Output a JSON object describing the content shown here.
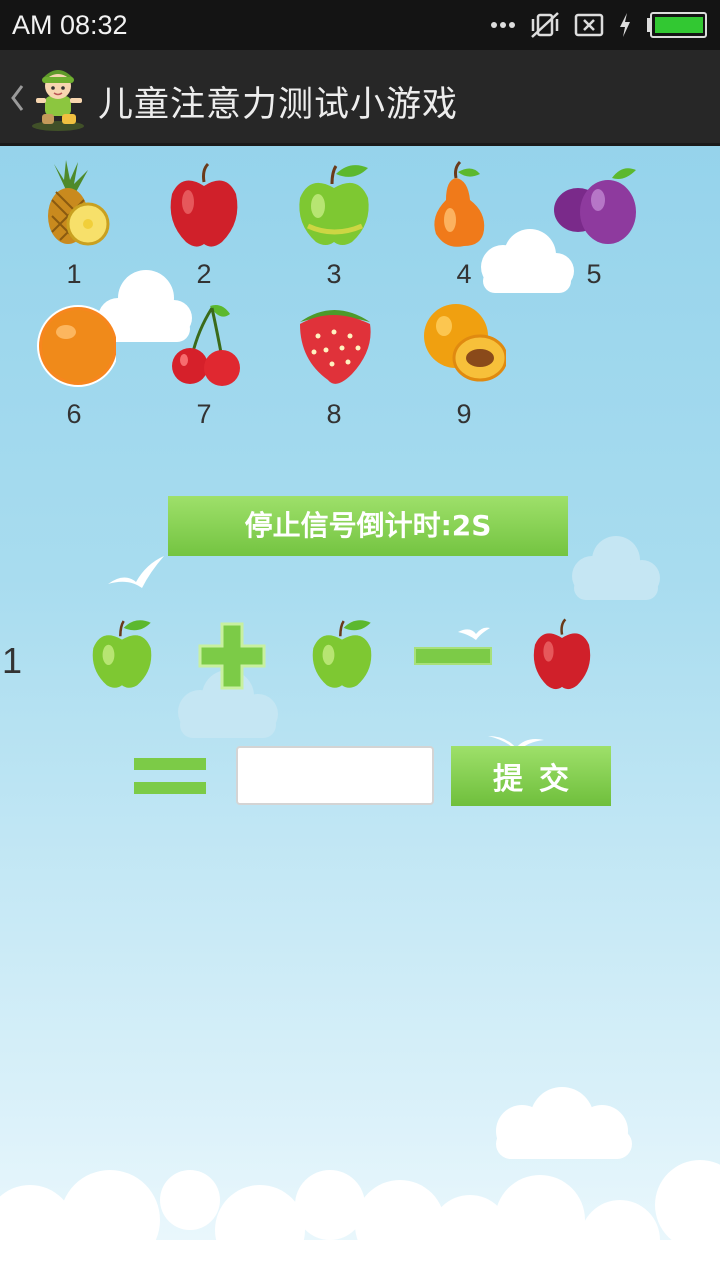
{
  "status_bar": {
    "time": "AM 08:32",
    "icons": [
      "more-dots-icon",
      "silent-vibrate-icon",
      "no-sim-icon",
      "charging-bolt-icon",
      "battery-icon"
    ],
    "battery_color": "#32c832"
  },
  "app_bar": {
    "title": "儿童注意力测试小游戏",
    "icons": [
      "back-chevron-icon",
      "boy-mascot-logo"
    ]
  },
  "fruits": [
    {
      "number": "1",
      "name": "pineapple"
    },
    {
      "number": "2",
      "name": "red-apple"
    },
    {
      "number": "3",
      "name": "green-apple"
    },
    {
      "number": "4",
      "name": "pear"
    },
    {
      "number": "5",
      "name": "plum"
    },
    {
      "number": "6",
      "name": "orange"
    },
    {
      "number": "7",
      "name": "cherry"
    },
    {
      "number": "8",
      "name": "strawberry"
    },
    {
      "number": "9",
      "name": "peach"
    }
  ],
  "countdown": {
    "text": "停止信号倒计时:2S"
  },
  "equation": {
    "index": "1",
    "terms": [
      "green-apple",
      "plus",
      "green-apple",
      "minus",
      "red-apple",
      "equals"
    ]
  },
  "answer": {
    "value": "",
    "placeholder": ""
  },
  "submit": {
    "label": "提交"
  },
  "colors": {
    "accent_green": "#7ccb47",
    "sky_top": "#8fd0ea",
    "sky_bottom": "#eef9fd",
    "app_bar_bg": "#272727"
  }
}
